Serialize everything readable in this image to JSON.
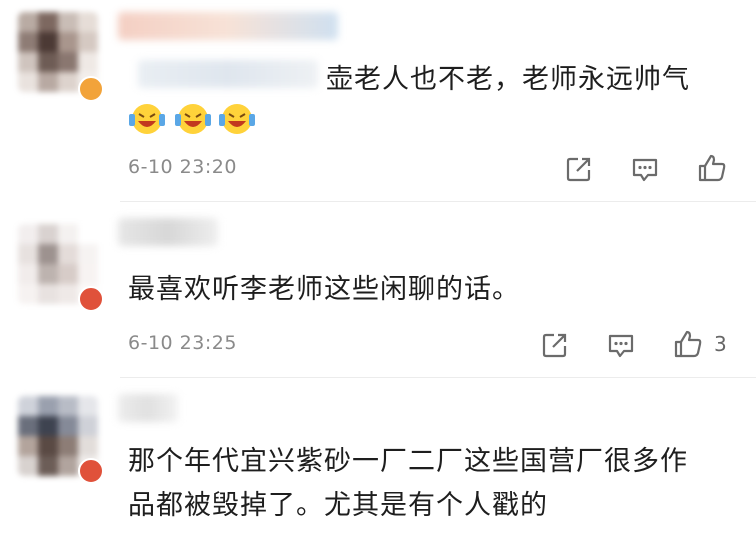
{
  "comments": [
    {
      "text_lines": [
        "壶老人也不老，老师永远帅气"
      ],
      "emojis": [
        "laughing-cry-emoji",
        "laughing-cry-emoji",
        "laughing-cry-emoji"
      ],
      "time": "6-10 23:20",
      "likes": ""
    },
    {
      "text_lines": [
        "最喜欢听李老师这些闲聊的话。"
      ],
      "emojis": [],
      "time": "6-10 23:25",
      "likes": "3"
    },
    {
      "text_lines": [
        "那个年代宜兴紫砂一厂二厂这些国营厂很多作",
        "品都被毁掉了。尤其是有个人戳的"
      ],
      "emojis": [],
      "time": "",
      "likes": ""
    }
  ],
  "actions": {
    "repost_icon": "share-icon",
    "comment_icon": "comment-icon",
    "like_icon": "thumbs-up-icon"
  },
  "colors": {
    "text": "#1e1e1e",
    "meta": "#8a8a8a",
    "icon": "#6b6b6b",
    "badge_gold": "#f2a33a",
    "badge_red": "#e0513a"
  }
}
